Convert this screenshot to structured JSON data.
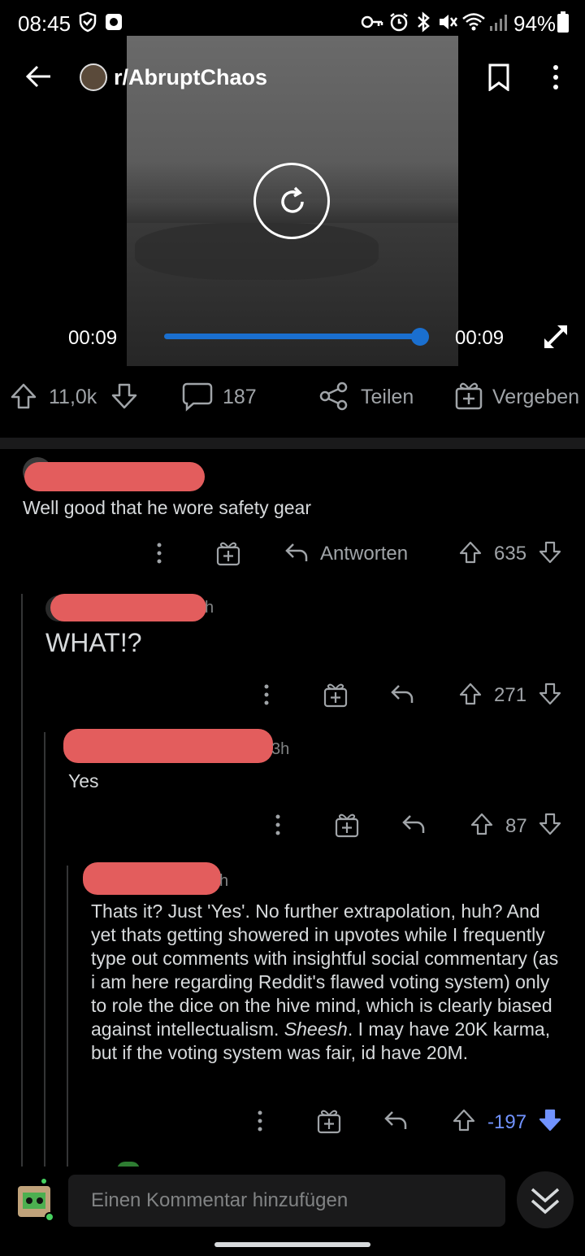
{
  "status_bar": {
    "time": "08:45",
    "battery": "94%"
  },
  "header": {
    "subreddit": "r/AbruptChaos"
  },
  "video": {
    "time_elapsed": "00:09",
    "time_total": "00:09",
    "progress": 1.0
  },
  "post_actions": {
    "upvotes": "11,0k",
    "comments": "187",
    "share_label": "Teilen",
    "award_label": "Vergeben"
  },
  "comments": [
    {
      "text": "Well good that he wore safety gear",
      "reply_label": "Antworten",
      "score": "635"
    },
    {
      "age_suffix": "h",
      "text": "WHAT!?",
      "score": "271"
    },
    {
      "age": "3h",
      "text": "Yes",
      "score": "87"
    },
    {
      "age_suffix": "h",
      "text_main": "Thats it? Just 'Yes'. No further extrapolation, huh? And yet thats getting showered in upvotes while I frequently type out comments with insightful social commentary (as i am here regarding Reddit's flawed voting system) only to role the dice on the hive mind, which is clearly biased against intellectualism.",
      "text_emph": "Sheesh",
      "text_end": ". I may have 20K karma, but if the voting system was fair, id have 20M.",
      "score": "-197"
    }
  ],
  "composer": {
    "placeholder": "Einen Kommentar hinzufügen"
  },
  "colors": {
    "accent_blue": "#1a6fcf",
    "downvote": "#7193ff",
    "redaction": "#e35d5d"
  }
}
